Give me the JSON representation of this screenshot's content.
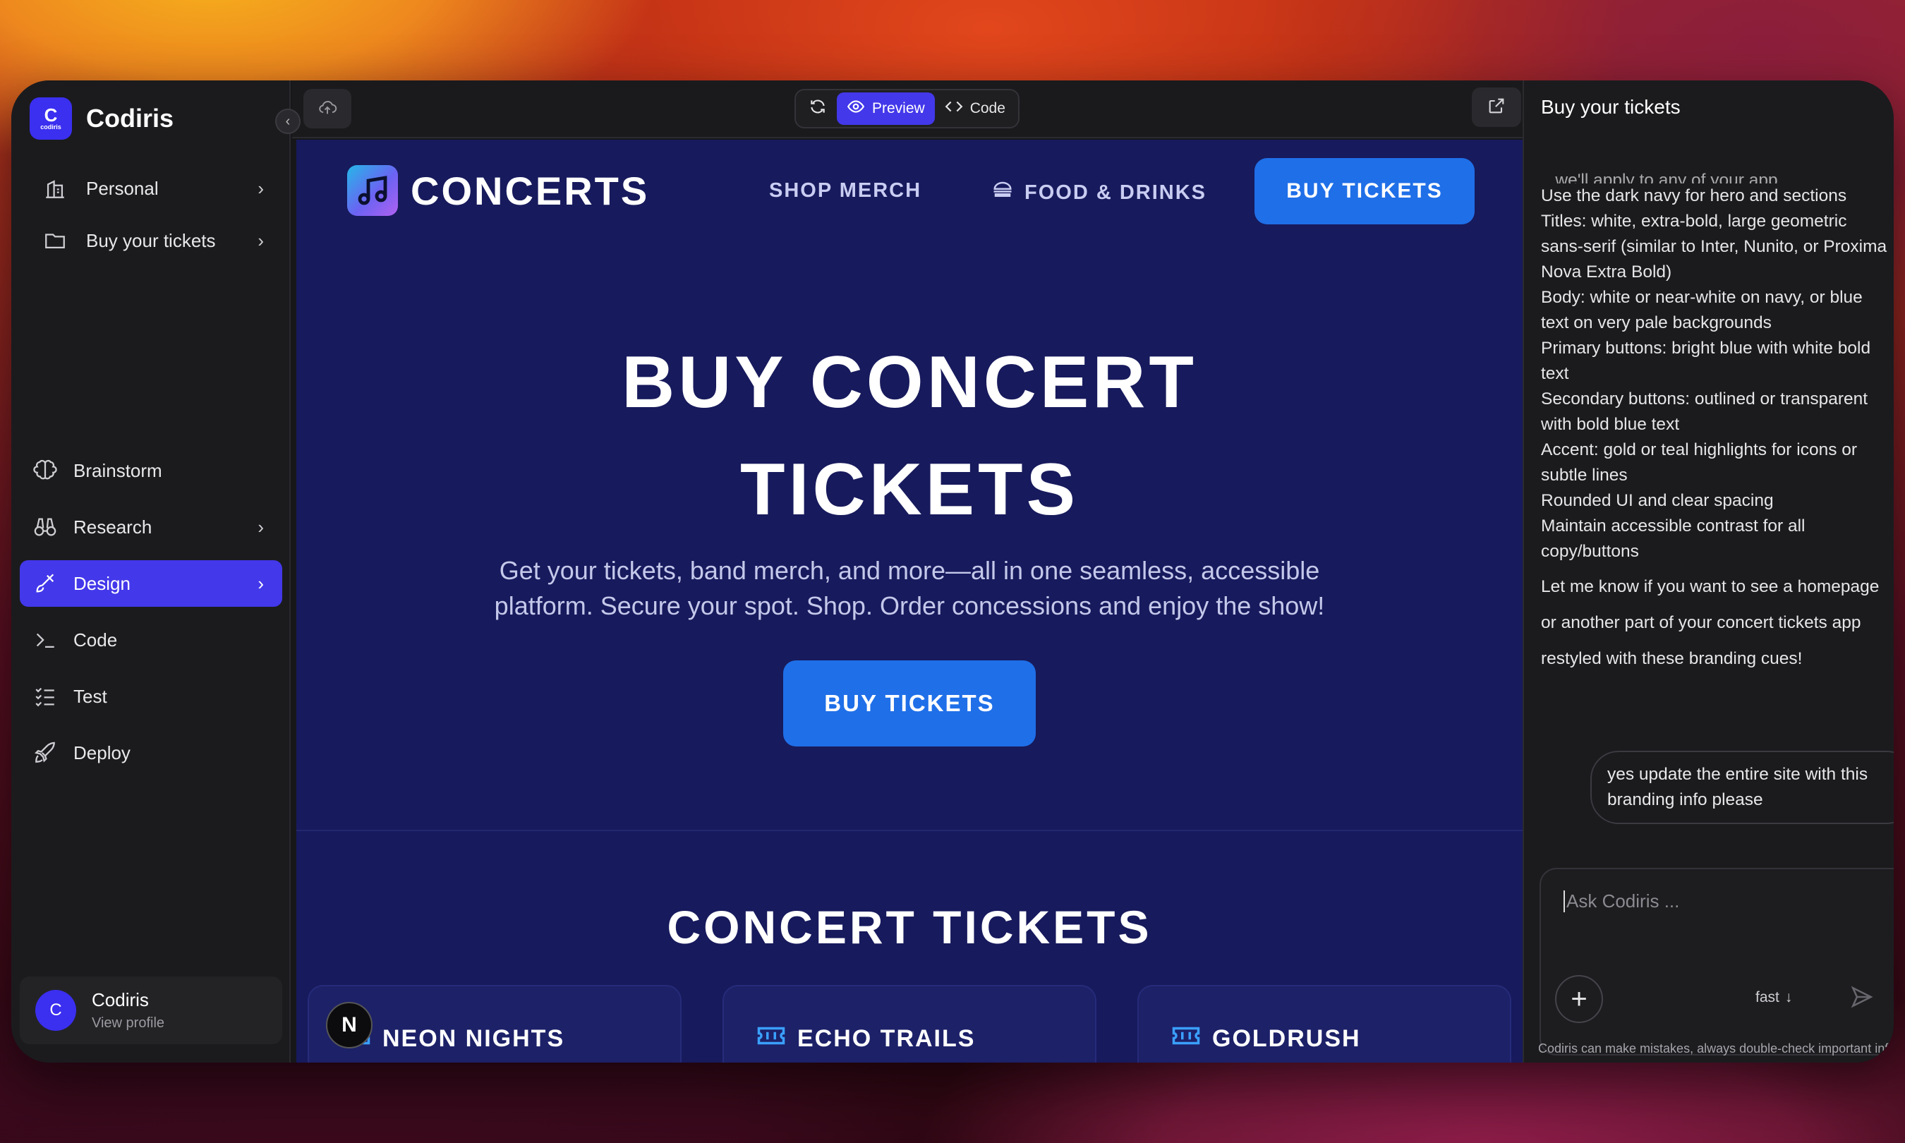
{
  "app": {
    "name": "Codiris",
    "logo_text": "C",
    "logo_subtext": "codiris"
  },
  "sidebar": {
    "top_items": [
      {
        "label": "Personal",
        "icon": "building-icon"
      },
      {
        "label": "Buy your tickets",
        "icon": "folder-icon"
      }
    ],
    "items": [
      {
        "label": "Brainstorm",
        "icon": "brain-icon"
      },
      {
        "label": "Research",
        "icon": "binoculars-icon"
      },
      {
        "label": "Design",
        "icon": "brush-icon",
        "active": true
      },
      {
        "label": "Code",
        "icon": "terminal-icon"
      },
      {
        "label": "Test",
        "icon": "checklist-icon"
      },
      {
        "label": "Deploy",
        "icon": "rocket-icon"
      }
    ],
    "profile": {
      "initial": "C",
      "name": "Codiris",
      "sub": "View profile"
    }
  },
  "toolbar": {
    "preview_label": "Preview",
    "code_label": "Code"
  },
  "site": {
    "brand": "CONCERTS",
    "nav": {
      "shop": "SHOP MERCH",
      "food": "FOOD & DRINKS",
      "cta": "BUY TICKETS"
    },
    "hero": {
      "title_line1": "BUY CONCERT",
      "title_line2": "TICKETS",
      "sub_line1": "Get your tickets, band merch, and more—all in one seamless, accessible",
      "sub_line2": "platform. Secure your spot. Shop. Order concessions and enjoy the show!",
      "button": "BUY TICKETS"
    },
    "section_title": "CONCERT TICKETS",
    "cards": [
      {
        "title": "NEON NIGHTS"
      },
      {
        "title": "ECHO TRAILS"
      },
      {
        "title": "GOLDRUSH"
      }
    ],
    "badge": "N"
  },
  "chat": {
    "title": "Buy your tickets",
    "cut_line": "...we'll apply to any of your app",
    "lines": [
      "Use the dark navy for hero and sections",
      "Titles: white, extra-bold, large geometric sans-serif (similar to Inter, Nunito, or Proxima Nova Extra Bold)",
      "Body: white or near-white on navy, or blue text on very pale backgrounds",
      "Primary buttons: bright blue with white bold text",
      "Secondary buttons: outlined or transparent with bold blue text",
      "Accent: gold or teal highlights for icons or subtle lines",
      "Rounded UI and clear spacing",
      "Maintain accessible contrast for all copy/buttons"
    ],
    "closing": "Let me know if you want to see a homepage or another part of your concert tickets app restyled with these branding cues!",
    "user_message": "yes update the entire site with this branding info please",
    "input_placeholder": "Ask Codiris ...",
    "model": "fast",
    "disclaimer": "Codiris can make mistakes, always double-check important info."
  },
  "colors": {
    "accent": "#4338ea",
    "site_bg": "#171a5c",
    "site_button": "#1f6fe8"
  }
}
